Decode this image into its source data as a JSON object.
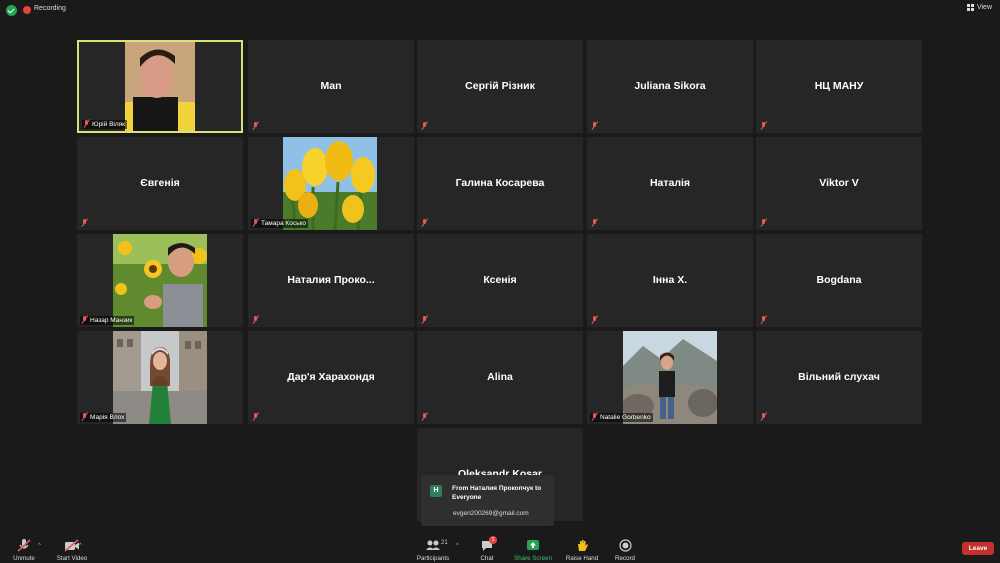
{
  "topbar": {
    "recording_label": "Recording",
    "view_label": "View"
  },
  "tiles": {
    "t_yuriy": {
      "label": "Юрій Віляк"
    },
    "t_man": {
      "name": "Man"
    },
    "t_serhiy": {
      "name": "Сергій Різник"
    },
    "t_juliana": {
      "name": "Juliana Sikora"
    },
    "t_nts": {
      "name": "НЦ МАНУ"
    },
    "t_evgenia": {
      "name": "Євгенія"
    },
    "t_tamara": {
      "label": "Тамара Косько"
    },
    "t_galina": {
      "name": "Галина Косарева"
    },
    "t_natalia": {
      "name": "Наталія"
    },
    "t_viktor": {
      "name": "Viktor V"
    },
    "t_nazar": {
      "label": "Назар Манзик"
    },
    "t_natalia_p": {
      "name": "Наталия  Проко..."
    },
    "t_ksenia": {
      "name": "Ксенія"
    },
    "t_inna": {
      "name": "Інна Х."
    },
    "t_bogdana": {
      "name": "Bogdana"
    },
    "t_maria": {
      "label": "Марія Влох"
    },
    "t_daria": {
      "name": "Дар'я  Харахондя"
    },
    "t_alina": {
      "name": "Alina"
    },
    "t_natalie_g": {
      "label": "Natalie Gorbenko"
    },
    "t_vilny": {
      "name": "Вільний слухач"
    },
    "t_oleksandra": {
      "name": "Oleksandr Kosar"
    }
  },
  "chat_popup": {
    "avatar": "Н",
    "from": "From Наталия Прокопчук to Everyone",
    "message": "evgen200269@gmail.com"
  },
  "controls": {
    "unmute": "Unmute",
    "start_video": "Start Video",
    "participants": "Participants",
    "participants_count": "21",
    "chat": "Chat",
    "chat_badge": "1",
    "share_screen": "Share Screen",
    "raise_hand": "Raise Hand",
    "record": "Record",
    "leave": "Leave"
  },
  "colors": {
    "background": "#1a1a1a",
    "tile": "#262626",
    "active_border": "#d9e27a",
    "share_green": "#23a455",
    "leave_red": "#c4312c"
  }
}
